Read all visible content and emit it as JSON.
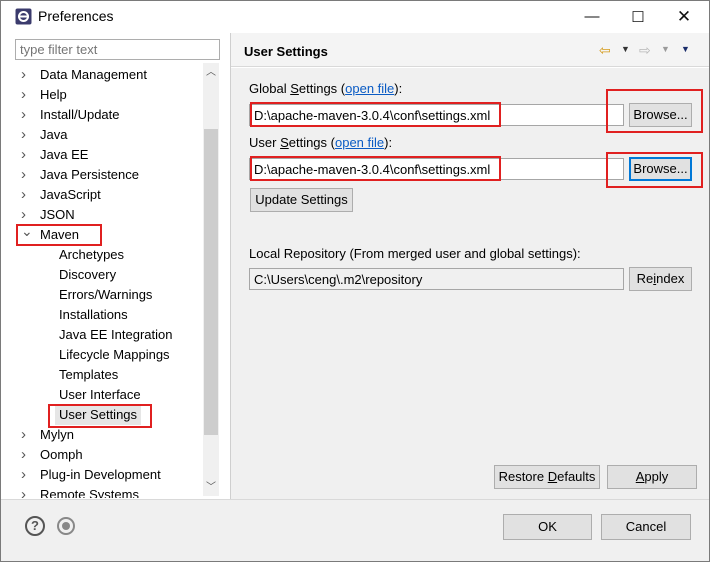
{
  "window": {
    "title": "Preferences",
    "minimize_glyph": "—",
    "maximize_glyph": "☐",
    "close_glyph": "✕"
  },
  "filter": {
    "placeholder": "type filter text"
  },
  "tree": {
    "items": [
      {
        "label": "Data Management",
        "level": 0,
        "arrow": "›"
      },
      {
        "label": "Help",
        "level": 0,
        "arrow": "›"
      },
      {
        "label": "Install/Update",
        "level": 0,
        "arrow": "›"
      },
      {
        "label": "Java",
        "level": 0,
        "arrow": "›"
      },
      {
        "label": "Java EE",
        "level": 0,
        "arrow": "›"
      },
      {
        "label": "Java Persistence",
        "level": 0,
        "arrow": "›"
      },
      {
        "label": "JavaScript",
        "level": 0,
        "arrow": "›"
      },
      {
        "label": "JSON",
        "level": 0,
        "arrow": "›"
      },
      {
        "label": "Maven",
        "level": 0,
        "arrow": "⌄"
      },
      {
        "label": "Archetypes",
        "level": 1
      },
      {
        "label": "Discovery",
        "level": 1
      },
      {
        "label": "Errors/Warnings",
        "level": 1
      },
      {
        "label": "Installations",
        "level": 1
      },
      {
        "label": "Java EE Integration",
        "level": 1
      },
      {
        "label": "Lifecycle Mappings",
        "level": 1
      },
      {
        "label": "Templates",
        "level": 1
      },
      {
        "label": "User Interface",
        "level": 1
      },
      {
        "label": "User Settings",
        "level": 1,
        "selected": true
      },
      {
        "label": "Mylyn",
        "level": 0,
        "arrow": "›"
      },
      {
        "label": "Oomph",
        "level": 0,
        "arrow": "›"
      },
      {
        "label": "Plug-in Development",
        "level": 0,
        "arrow": "›"
      },
      {
        "label": "Remote Systems",
        "level": 0,
        "arrow": "›"
      }
    ]
  },
  "page": {
    "title": "User Settings",
    "global_label_pre": "Global ",
    "global_label_u": "S",
    "global_label_post": "ettings (",
    "global_link": "open file",
    "global_label_end": "):",
    "global_path": "D:\\apache-maven-3.0.4\\conf\\settings.xml",
    "user_label_pre": "User ",
    "user_label_u": "S",
    "user_label_post": "ettings (",
    "user_link": "open file",
    "user_label_end": "):",
    "user_path": "D:\\apache-maven-3.0.4\\conf\\settings.xml",
    "browse_label": "Browse...",
    "update_settings_label": "Update Settings",
    "local_repo_label": "Local Repository (From merged user and global settings):",
    "local_repo_path": "C:\\Users\\ceng\\.m2\\repository",
    "reindex_pre": "Re",
    "reindex_u": "i",
    "reindex_post": "ndex",
    "restore_pre": "Restore ",
    "restore_u": "D",
    "restore_post": "efaults",
    "apply_u": "A",
    "apply_post": "pply"
  },
  "footer": {
    "ok_label": "OK",
    "cancel_label": "Cancel"
  },
  "colors": {
    "highlight_box": "#e02020",
    "link": "#0a5bc4",
    "focus_border": "#0078d7"
  }
}
